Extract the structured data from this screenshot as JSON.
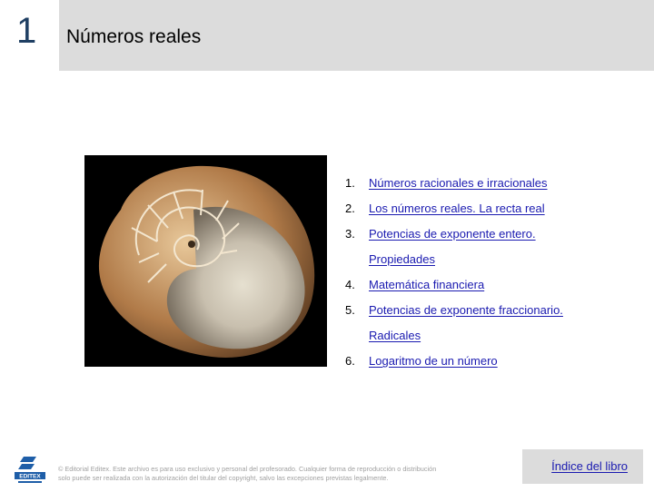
{
  "header": {
    "chapter_number": "1",
    "title": "Números reales"
  },
  "image": {
    "subject": "nautilus-shell"
  },
  "toc": {
    "items": [
      {
        "num": "1.",
        "lines": [
          "Números racionales e irracionales"
        ]
      },
      {
        "num": "2.",
        "lines": [
          "Los números reales. La recta real"
        ]
      },
      {
        "num": "3.",
        "lines": [
          "Potencias de exponente entero.",
          "Propiedades"
        ]
      },
      {
        "num": "4.",
        "lines": [
          "Matemática financiera"
        ]
      },
      {
        "num": "5.",
        "lines": [
          "Potencias de exponente fraccionario.",
          "Radicales"
        ]
      },
      {
        "num": "6.",
        "lines": [
          "Logaritmo de un número"
        ]
      }
    ]
  },
  "footer": {
    "logo_text": "EDITEX",
    "copyright_line1": "© Editorial Editex. Este archivo es para uso exclusivo y personal del profesorado. Cualquier forma de reproducción o distribución",
    "copyright_line2": "solo puede ser realizada con la autorización del titular del copyright, salvo las excepciones previstas legalmente.",
    "index_label": "Índice del libro"
  },
  "colors": {
    "title_bar": "#dcdcdc",
    "link": "#1a1ab0",
    "chapter_number": "#1f3f63",
    "logo": "#1e5ea8"
  }
}
